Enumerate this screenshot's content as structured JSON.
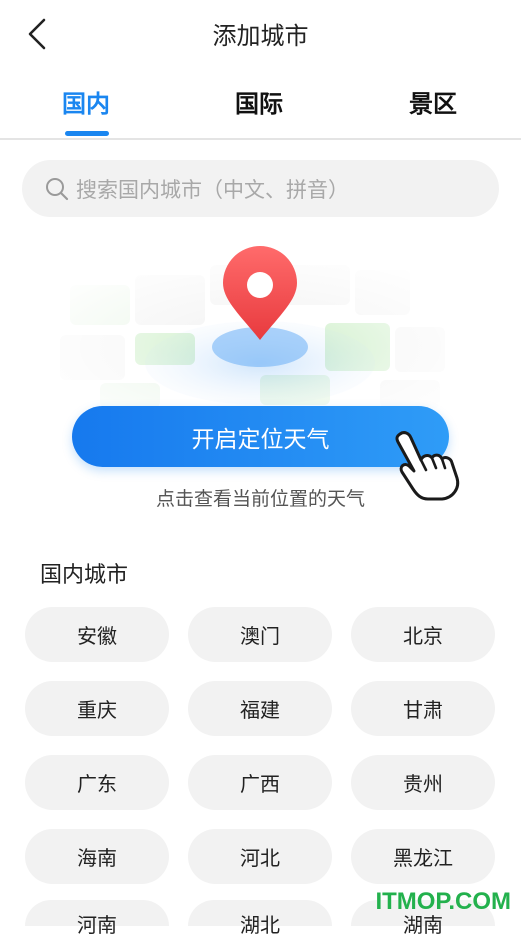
{
  "header": {
    "title": "添加城市",
    "back_icon": "chevron-left-icon"
  },
  "tabs": [
    {
      "label": "国内",
      "active": true
    },
    {
      "label": "国际",
      "active": false
    },
    {
      "label": "景区",
      "active": false
    }
  ],
  "colors": {
    "accent": "#1a86f0",
    "pin": "#f0474a",
    "watermark": "#23b14d"
  },
  "search": {
    "placeholder": "搜索国内城市（中文、拼音）",
    "icon": "search-icon"
  },
  "locate": {
    "button_label": "开启定位天气",
    "hint": "点击查看当前位置的天气",
    "pin_icon": "location-pin-icon",
    "hand_icon": "pointing-hand-icon"
  },
  "cities": {
    "section_title": "国内城市",
    "items": [
      "安徽",
      "澳门",
      "北京",
      "重庆",
      "福建",
      "甘肃",
      "广东",
      "广西",
      "贵州",
      "海南",
      "河北",
      "黑龙江",
      "河南",
      "湖北",
      "湖南"
    ]
  },
  "watermark": "ITMOP.COM"
}
